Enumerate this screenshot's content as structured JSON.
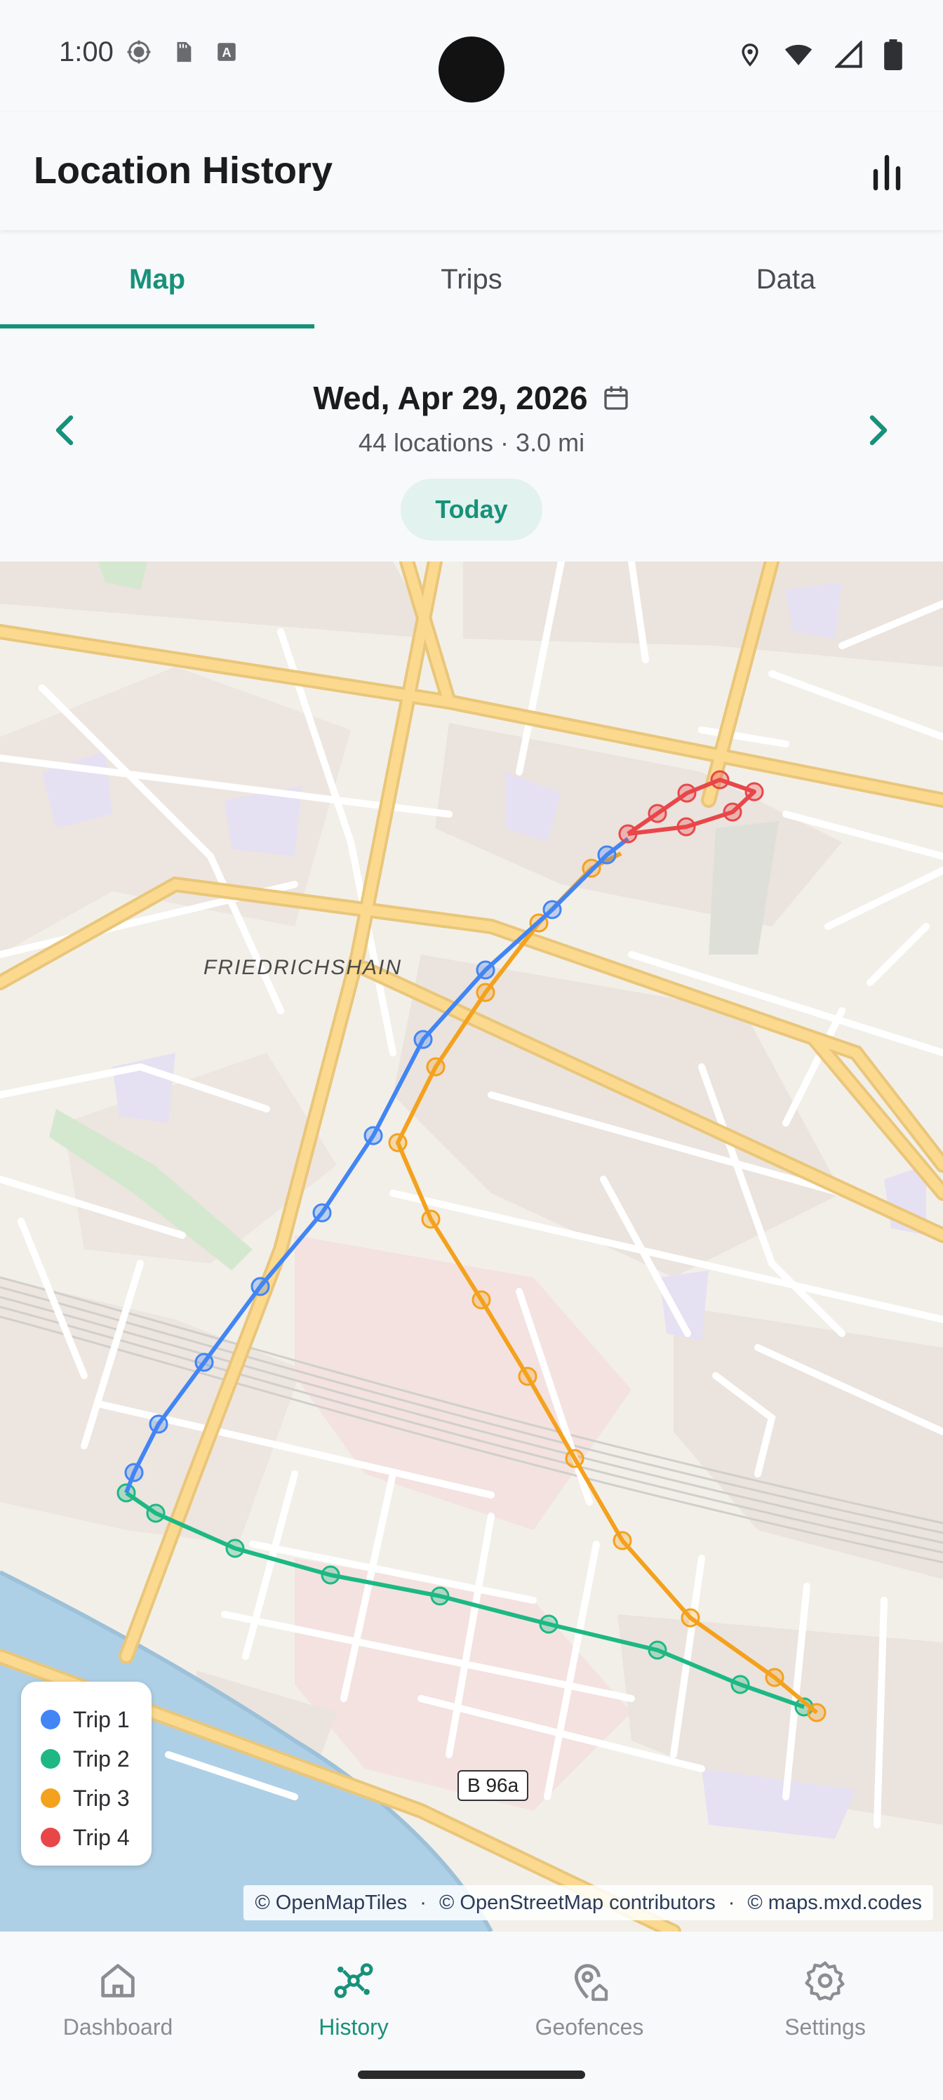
{
  "status_bar": {
    "time": "1:00"
  },
  "app_bar": {
    "title": "Location History",
    "stats_icon": "bar-chart-icon"
  },
  "tabs": [
    {
      "label": "Map",
      "active": true
    },
    {
      "label": "Trips",
      "active": false
    },
    {
      "label": "Data",
      "active": false
    }
  ],
  "date_nav": {
    "date": "Wed, Apr 29, 2026",
    "summary": "44 locations · 3.0 mi",
    "today_label": "Today"
  },
  "map": {
    "district_label": "FRIEDRICHSHAIN",
    "road_label": "B 96a",
    "attribution": [
      "© OpenMapTiles",
      "© OpenStreetMap contributors",
      "© maps.mxd.codes"
    ],
    "legend": [
      {
        "label": "Trip 1",
        "color": "#4285f4"
      },
      {
        "label": "Trip 2",
        "color": "#1db884"
      },
      {
        "label": "Trip 3",
        "color": "#f4a11d"
      },
      {
        "label": "Trip 4",
        "color": "#e8474a"
      }
    ]
  },
  "bottom_nav": [
    {
      "label": "Dashboard",
      "icon": "home-icon",
      "active": false
    },
    {
      "label": "History",
      "icon": "route-icon",
      "active": true
    },
    {
      "label": "Geofences",
      "icon": "geofence-icon",
      "active": false
    },
    {
      "label": "Settings",
      "icon": "gear-icon",
      "active": false
    }
  ],
  "colors": {
    "accent": "#17917a"
  }
}
